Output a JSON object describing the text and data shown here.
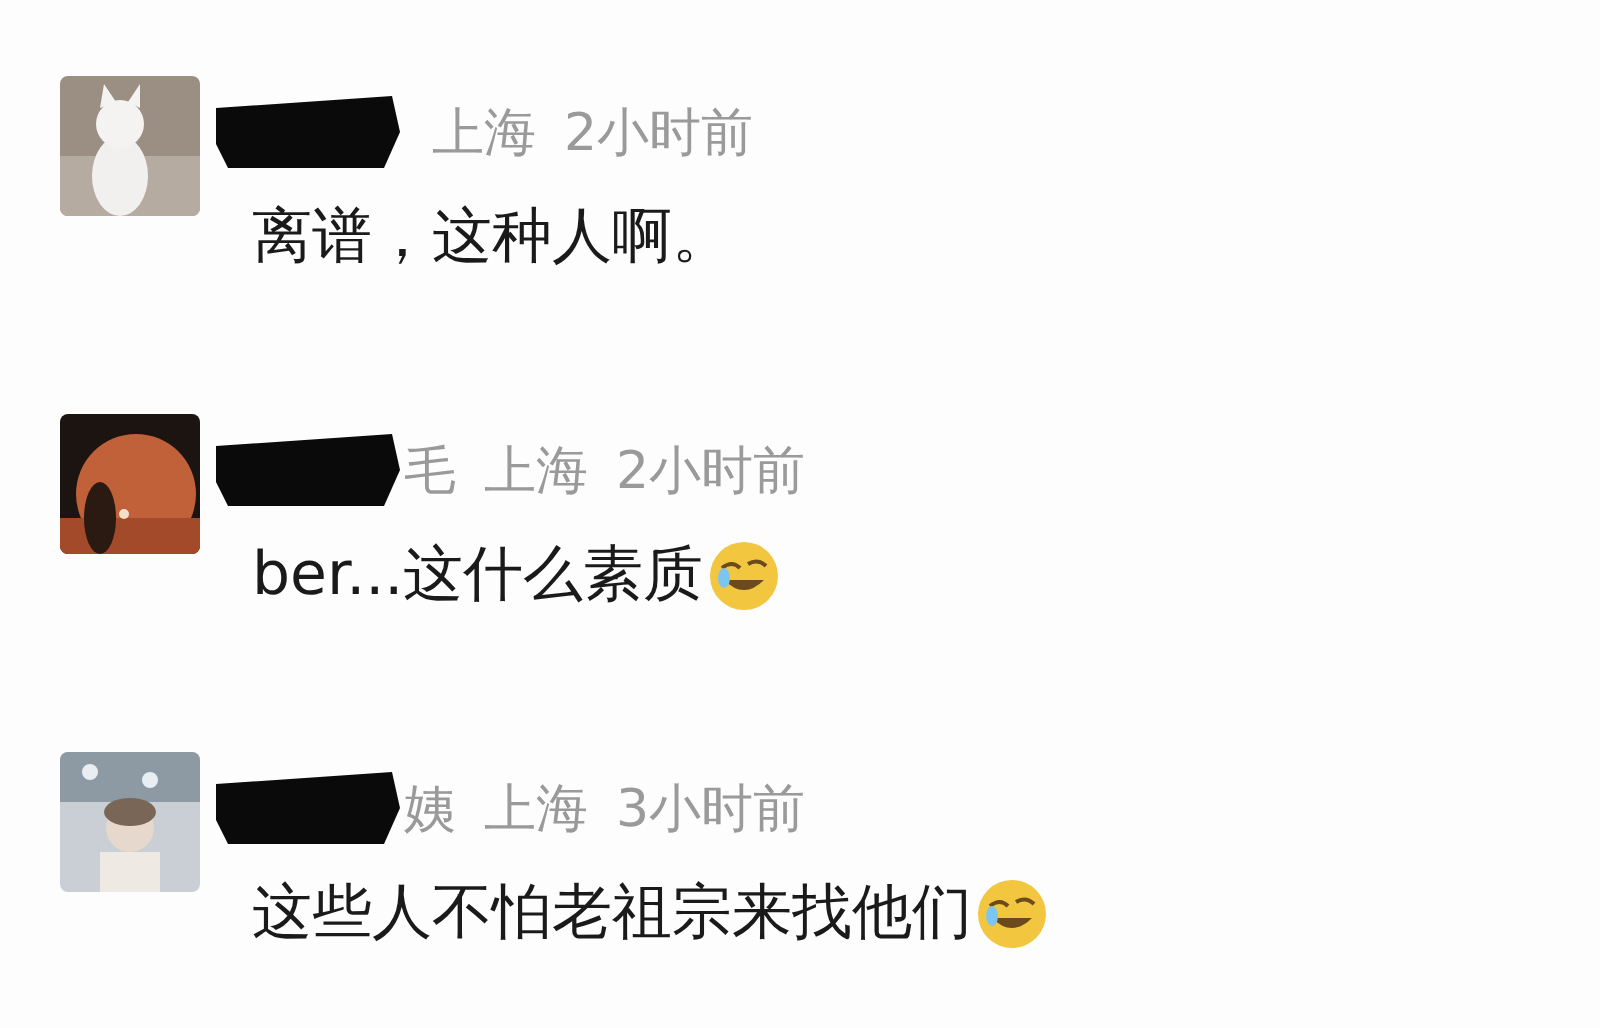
{
  "comments": [
    {
      "location": "上海",
      "time": "2小时前",
      "text": "离谱，这种人啊。",
      "emoji": false
    },
    {
      "name": "毛",
      "location": "上海",
      "time": "2小时前",
      "text": "ber...这什么素质",
      "emoji": true
    },
    {
      "name": "姨",
      "location": "上海",
      "time": "3小时前",
      "text": "这些人不怕老祖宗来找他们",
      "emoji": true
    }
  ]
}
